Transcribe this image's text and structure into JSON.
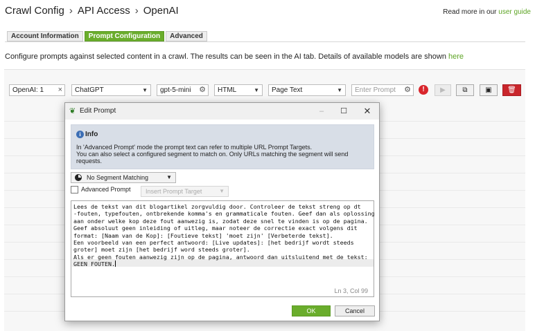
{
  "breadcrumb": [
    "Crawl Config",
    "API Access",
    "OpenAI"
  ],
  "breadcrumb_sep": "›",
  "guide": {
    "prefix": "Read more in our",
    "link": "user guide"
  },
  "tabs": [
    {
      "label": "Account Information",
      "active": false
    },
    {
      "label": "Prompt Configuration",
      "active": true
    },
    {
      "label": "Advanced",
      "active": false
    }
  ],
  "description": {
    "text": "Configure prompts against selected content in a crawl. The results can be seen in the AI tab. Details of available models are shown",
    "link": "here"
  },
  "prompt_row": {
    "name": "OpenAI: 1",
    "provider": "ChatGPT",
    "model": "gpt-5-mini",
    "format": "HTML",
    "content_type": "Page Text",
    "prompt_placeholder": "Enter Prompt",
    "warning_glyph": "!"
  },
  "dialog": {
    "title": "Edit Prompt",
    "info_title": "Info",
    "info_lines": [
      "In 'Advanced Prompt' mode the prompt text can refer to multiple URL Prompt Targets.",
      "You can also select a configured segment to match on. Only URLs matching the segment will send",
      "requests."
    ],
    "segment": "No Segment Matching",
    "advanced_label": "Advanced Prompt",
    "advanced_checked": false,
    "insert_target": "Insert Prompt Target",
    "prompt_lines": [
      "Lees de tekst van dit blogartikel zorgvuldig door. Controleer de tekst streng op dt",
      "-fouten, typefouten, ontbrekende komma's en grammaticale fouten. Geef dan als oplossing",
      "aan onder welke kop deze fout aanwezig is, zodat deze snel te vinden is op de pagina.",
      "Geef absoluut geen inleiding of uitleg, maar noteer de correctie exact volgens dit",
      "format: [Naam van de Kop]: [Foutieve tekst] 'moet zijn' [Verbeterde tekst].",
      "Een voorbeeld van een perfect antwoord: [Live updates]: [het bedrijf wordt steeds",
      "groter] moet zijn [het bedrijf word steeds groter].",
      "Als er geen fouten aanwezig zijn op de pagina, antwoord dan uitsluitend met de tekst:",
      "GEEN FOUTEN."
    ],
    "cursor_position": "Ln 3, Col 99",
    "ok": "OK",
    "cancel": "Cancel"
  },
  "colors": {
    "accent": "#6aad2c",
    "danger": "#c9262c",
    "info_bg": "#d8dee7"
  },
  "icons": [
    "leaf-icon",
    "minimize-icon",
    "maximize-icon",
    "close-icon",
    "info-icon",
    "segment-pie-icon",
    "gear-icon",
    "warning-icon",
    "play-icon",
    "copy-icon",
    "save-icon",
    "delete-icon"
  ]
}
